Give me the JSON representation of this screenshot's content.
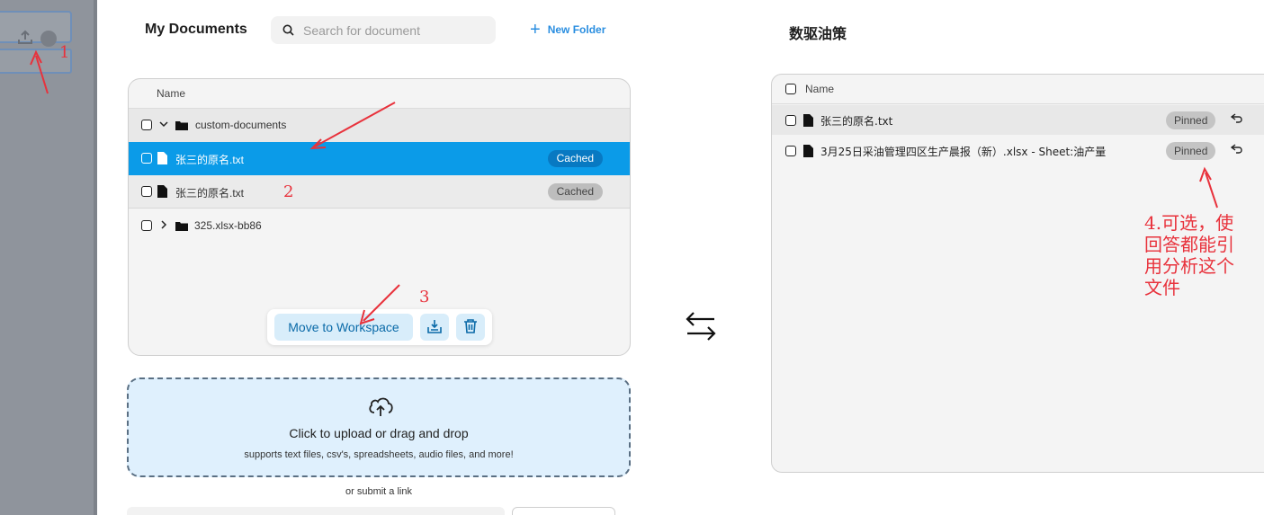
{
  "header": {
    "title": "My Documents",
    "search_placeholder": "Search for document",
    "new_folder_label": "New Folder"
  },
  "documents": {
    "column_name": "Name",
    "rows": [
      {
        "label": "custom-documents",
        "type": "folder",
        "expanded": true
      },
      {
        "label": "张三的原名.txt",
        "type": "file",
        "badge": "Cached",
        "selected": true
      },
      {
        "label": "张三的原名.txt",
        "type": "file",
        "badge": "Cached",
        "selected": false
      },
      {
        "label": "325.xlsx-bb86",
        "type": "folder",
        "expanded": false
      }
    ],
    "actions": {
      "move_label": "Move to Workspace",
      "embed_icon": "embed-icon",
      "delete_icon": "trash-icon"
    }
  },
  "upload": {
    "title": "Click to upload or drag and drop",
    "subtitle": "supports text files, csv's, spreadsheets, audio files, and more!",
    "or_link": "or submit a link"
  },
  "workspace": {
    "title": "数驱油策",
    "column_name": "Name",
    "rows": [
      {
        "label": "张三的原名.txt",
        "badge": "Pinned"
      },
      {
        "label": "3月25日采油管理四区生产晨报（新）.xlsx - Sheet:油产量",
        "badge": "Pinned"
      }
    ]
  },
  "annotations": {
    "n1": "1",
    "n2": "2",
    "n3": "3",
    "n4_line1": "4.可选，使",
    "n4_line2": "回答都能引",
    "n4_line3": "用分析这个",
    "n4_line4": "文件",
    "color": "#e8323c"
  },
  "colors": {
    "accent": "#0b9be8",
    "link": "#2a8ee0",
    "sidebar_dim": "#8f949c"
  }
}
